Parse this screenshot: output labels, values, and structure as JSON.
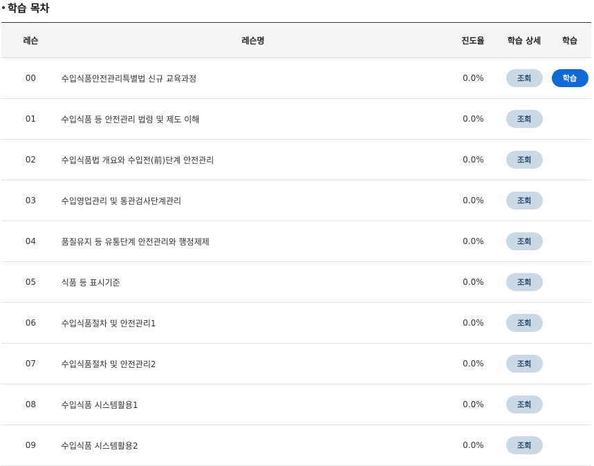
{
  "section": {
    "title": "학습 목차"
  },
  "table": {
    "headers": {
      "lesson": "레슨",
      "lesson_name": "레슨명",
      "progress": "진도율",
      "detail": "학습 상세",
      "study": "학습"
    },
    "rows": [
      {
        "num": "00",
        "name": "수입식품안전관리특별법 신규 교육과정",
        "progress": "0.0%",
        "detail_btn": "조회",
        "study_btn": "학습"
      },
      {
        "num": "01",
        "name": "수입식품 등 안전관리 법령 및 제도 이해",
        "progress": "0.0%",
        "detail_btn": "조회"
      },
      {
        "num": "02",
        "name": "수입식품법 개요와 수입전(前)단계 안전관리",
        "progress": "0.0%",
        "detail_btn": "조회"
      },
      {
        "num": "03",
        "name": "수입영업관리 및 통관검사단계관리",
        "progress": "0.0%",
        "detail_btn": "조회"
      },
      {
        "num": "04",
        "name": "품질유지 등 유통단계 안전관리와 행정제제",
        "progress": "0.0%",
        "detail_btn": "조회"
      },
      {
        "num": "05",
        "name": "식품 등 표시기준",
        "progress": "0.0%",
        "detail_btn": "조회"
      },
      {
        "num": "06",
        "name": "수입식품절차 및 안전관리1",
        "progress": "0.0%",
        "detail_btn": "조회"
      },
      {
        "num": "07",
        "name": "수입식품절차 및 안전관리2",
        "progress": "0.0%",
        "detail_btn": "조회"
      },
      {
        "num": "08",
        "name": "수입식품 시스템활용1",
        "progress": "0.0%",
        "detail_btn": "조회"
      },
      {
        "num": "09",
        "name": "수입식품 시스템활용2",
        "progress": "0.0%",
        "detail_btn": "조회"
      }
    ]
  },
  "colors": {
    "view_button_bg": "#cbd8e6",
    "study_button_bg": "#1169d6",
    "header_bg": "#f4f5f7"
  }
}
